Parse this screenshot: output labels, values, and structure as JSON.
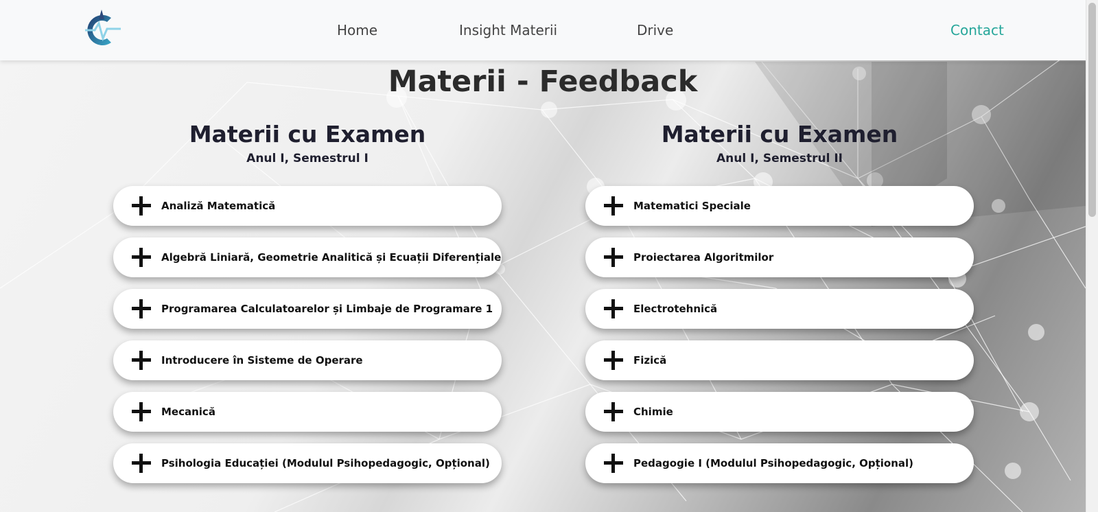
{
  "navbar": {
    "links": [
      {
        "label": "Home"
      },
      {
        "label": "Insight Materii"
      },
      {
        "label": "Drive"
      },
      {
        "label": "Contact"
      }
    ]
  },
  "page": {
    "title": "Materii - Feedback"
  },
  "columns": [
    {
      "heading": "Materii cu Examen",
      "subheading": "Anul I, Semestrul I",
      "items": [
        {
          "label": "Analiză Matematică"
        },
        {
          "label": "Algebră Liniară, Geometrie Analitică și Ecuații Diferențiale"
        },
        {
          "label": "Programarea Calculatoarelor și Limbaje de Programare 1"
        },
        {
          "label": "Introducere în Sisteme de Operare"
        },
        {
          "label": "Mecanică"
        },
        {
          "label": "Psihologia Educației (Modulul Psihopedagogic, Opțional)"
        }
      ]
    },
    {
      "heading": "Materii cu Examen",
      "subheading": "Anul I, Semestrul II",
      "items": [
        {
          "label": "Matematici Speciale"
        },
        {
          "label": "Proiectarea Algoritmilor"
        },
        {
          "label": "Electrotehnică"
        },
        {
          "label": "Fizică"
        },
        {
          "label": "Chimie"
        },
        {
          "label": "Pedagogie I (Modulul Psihopedagogic, Opțional)"
        }
      ]
    }
  ],
  "colors": {
    "accent": "#26a69a",
    "nav_text": "#444444",
    "heading": "#1f1f2f"
  },
  "icons": {
    "logo": "logo-icon",
    "expand": "plus-icon"
  }
}
